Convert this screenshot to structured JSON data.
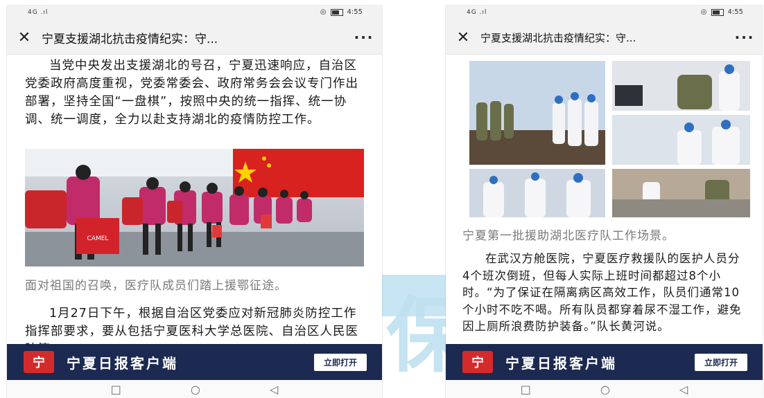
{
  "left": {
    "status": {
      "signal": "4G .ıl",
      "time": "4:55"
    },
    "nav": {
      "title": "宁夏支援湖北抗击疫情纪实：守...",
      "more": "···"
    },
    "para1": "当党中央发出支援湖北的号召，宁夏迅速响应，自治区党委政府高度重视，党委常委会、政府常务会会议专门作出部署，坚持全国“一盘棋”，按照中央的统一指挥、统一协调、统一调度，全力以赴支持湖北的疫情防控工作。",
    "caption": "面对祖国的召唤，医疗队成员们踏上援鄂征途。",
    "para2": "1月27日下午，根据自治区党委应对新冠肺炎防控工作指挥部要求，要从包括宁夏医科大学总医院、自治区人民医院等",
    "bag_text": "CAMEL"
  },
  "right": {
    "status": {
      "signal": "4G .ıl",
      "time": "4:55"
    },
    "nav": {
      "title": "宁夏支援湖北抗击疫情纪实：守...",
      "more": "···"
    },
    "caption": "宁夏第一批援助湖北医疗队工作场景。",
    "para": "在武汉方舱医院，宁夏医疗救援队的医护人员分4个班次倒班，但每人实际上班时间都超过8个小时。“为了保证在隔离病区高效工作，队员们通常10个小时不吃不喝。所有队员都穿着尿不湿工作，避免因上厕所浪费防护装备。”队长黄河说。"
  },
  "banner": {
    "logo": "宁",
    "name": "宁夏日报客户端",
    "open": "立即打开"
  },
  "sysnav": {
    "square": "□",
    "circle": "○",
    "back": "◁"
  },
  "watermark": "保",
  "colors": {
    "banner": "#1c2a52",
    "logo": "#d32b2b",
    "caption": "#7a7a7a"
  }
}
